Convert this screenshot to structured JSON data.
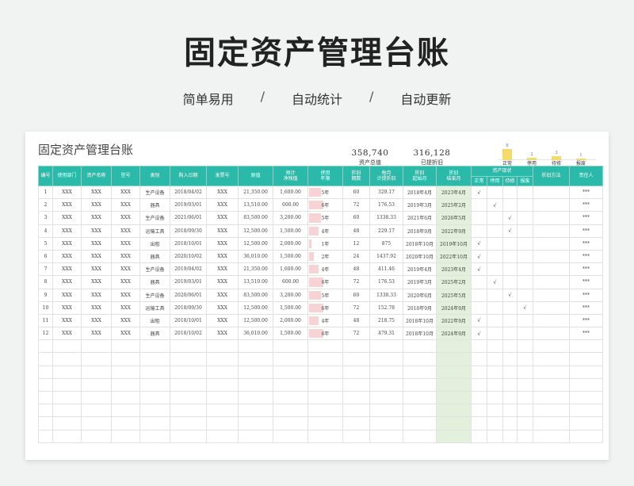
{
  "hero": {
    "title": "固定资产管理台账",
    "tags": [
      "简单易用",
      "自动统计",
      "自动更新"
    ],
    "separator": "/"
  },
  "sheet": {
    "title": "固定资产管理台账",
    "kpis": [
      {
        "value": "358,740",
        "label": "资产总值"
      },
      {
        "value": "316,128",
        "label": "已提折旧"
      }
    ],
    "status_chart": {
      "type": "bar",
      "categories": [
        "正常",
        "停用",
        "待修",
        "报废"
      ],
      "values": [
        8,
        2,
        3,
        1
      ],
      "bar_color": "#f6d96b"
    }
  },
  "colors": {
    "header_bg": "#2bb9a9",
    "life_bar": "#f8d3d6",
    "end_month_bg": "#e3f1dc",
    "end_month_text": "#c0392b"
  },
  "table": {
    "headers": [
      "编号",
      "使用部门",
      "资产名称",
      "型号",
      "类别",
      "购入日期",
      "发票号",
      "原值",
      "预计\n净残值",
      "使用\n年限",
      "折旧\n期数",
      "每月\n计提折旧",
      "折旧\n起始月",
      "折旧\n结束月",
      "资产现状",
      "折旧方法",
      "责任人"
    ],
    "status_headers": [
      "正常",
      "停用",
      "待修",
      "报废"
    ],
    "check": "√",
    "rows": [
      {
        "id": "1",
        "dept": "XXX",
        "name": "XXX",
        "model": "XXX",
        "category": "生产设备",
        "date": "2018/04/02",
        "invoice": "XXX",
        "cost": "21,350.00",
        "salvage": "1,600.00",
        "life": "5年",
        "life_ratio": 0.5,
        "periods": "60",
        "monthly": "329.17",
        "start": "2018年4月",
        "end": "2023年4月",
        "status": "正常",
        "method": "",
        "owner": "***"
      },
      {
        "id": "2",
        "dept": "XXX",
        "name": "XXX",
        "model": "XXX",
        "category": "器具",
        "date": "2019/03/01",
        "invoice": "XXX",
        "cost": "13,510.00",
        "salvage": "600.00",
        "life": "6年",
        "life_ratio": 0.6,
        "periods": "72",
        "monthly": "176.53",
        "start": "2019年3月",
        "end": "2025年2月",
        "status": "停用",
        "method": "",
        "owner": "***"
      },
      {
        "id": "3",
        "dept": "XXX",
        "name": "XXX",
        "model": "XXX",
        "category": "生产设备",
        "date": "2021/06/01",
        "invoice": "XXX",
        "cost": "83,500.00",
        "salvage": "3,200.00",
        "life": "5年",
        "life_ratio": 0.5,
        "periods": "60",
        "monthly": "1338.33",
        "start": "2021年6月",
        "end": "2026年5月",
        "status": "待修",
        "method": "",
        "owner": "***"
      },
      {
        "id": "4",
        "dept": "XXX",
        "name": "XXX",
        "model": "XXX",
        "category": "运输工具",
        "date": "2018/09/30",
        "invoice": "XXX",
        "cost": "12,500.00",
        "salvage": "1,500.00",
        "life": "4年",
        "life_ratio": 0.4,
        "periods": "48",
        "monthly": "229.17",
        "start": "2018年9月",
        "end": "2022年9月",
        "status": "待修",
        "method": "",
        "owner": "***"
      },
      {
        "id": "5",
        "dept": "XXX",
        "name": "XXX",
        "model": "XXX",
        "category": "出租",
        "date": "2018/10/01",
        "invoice": "XXX",
        "cost": "12,500.00",
        "salvage": "2,000.00",
        "life": "1年",
        "life_ratio": 0.1,
        "periods": "12",
        "monthly": "875",
        "start": "2018年10月",
        "end": "2019年10月",
        "status": "正常",
        "method": "",
        "owner": "***"
      },
      {
        "id": "6",
        "dept": "XXX",
        "name": "XXX",
        "model": "XXX",
        "category": "器具",
        "date": "2020/10/02",
        "invoice": "XXX",
        "cost": "36,010.00",
        "salvage": "1,500.00",
        "life": "2年",
        "life_ratio": 0.2,
        "periods": "24",
        "monthly": "1437.92",
        "start": "2020年10月",
        "end": "2022年10月",
        "status": "正常",
        "method": "",
        "owner": "***"
      },
      {
        "id": "7",
        "dept": "XXX",
        "name": "XXX",
        "model": "XXX",
        "category": "生产设备",
        "date": "2019/04/02",
        "invoice": "XXX",
        "cost": "21,350.00",
        "salvage": "1,600.00",
        "life": "4年",
        "life_ratio": 0.4,
        "periods": "48",
        "monthly": "411.46",
        "start": "2019年4月",
        "end": "2023年4月",
        "status": "正常",
        "method": "",
        "owner": "***"
      },
      {
        "id": "8",
        "dept": "XXX",
        "name": "XXX",
        "model": "XXX",
        "category": "器具",
        "date": "2019/03/01",
        "invoice": "XXX",
        "cost": "13,510.00",
        "salvage": "600.00",
        "life": "6年",
        "life_ratio": 0.6,
        "periods": "72",
        "monthly": "176.53",
        "start": "2019年3月",
        "end": "2025年2月",
        "status": "停用",
        "method": "",
        "owner": "***"
      },
      {
        "id": "9",
        "dept": "XXX",
        "name": "XXX",
        "model": "XXX",
        "category": "生产设备",
        "date": "2020/06/01",
        "invoice": "XXX",
        "cost": "83,500.00",
        "salvage": "3,200.00",
        "life": "5年",
        "life_ratio": 0.5,
        "periods": "60",
        "monthly": "1338.33",
        "start": "2020年6月",
        "end": "2025年5月",
        "status": "待修",
        "method": "",
        "owner": "***"
      },
      {
        "id": "10",
        "dept": "XXX",
        "name": "XXX",
        "model": "XXX",
        "category": "运输工具",
        "date": "2018/09/30",
        "invoice": "XXX",
        "cost": "12,500.00",
        "salvage": "1,500.00",
        "life": "6年",
        "life_ratio": 0.6,
        "periods": "72",
        "monthly": "152.78",
        "start": "2018年9月",
        "end": "2024年9月",
        "status": "报废",
        "method": "",
        "owner": "***"
      },
      {
        "id": "11",
        "dept": "XXX",
        "name": "XXX",
        "model": "XXX",
        "category": "出租",
        "date": "2018/10/01",
        "invoice": "XXX",
        "cost": "12,500.00",
        "salvage": "2,000.00",
        "life": "4年",
        "life_ratio": 0.4,
        "periods": "48",
        "monthly": "218.75",
        "start": "2018年10月",
        "end": "2022年9月",
        "status": "正常",
        "method": "",
        "owner": "***"
      },
      {
        "id": "12",
        "dept": "XXX",
        "name": "XXX",
        "model": "XXX",
        "category": "器具",
        "date": "2018/10/02",
        "invoice": "XXX",
        "cost": "36,010.00",
        "salvage": "1,500.00",
        "life": "6年",
        "life_ratio": 0.6,
        "periods": "72",
        "monthly": "479.31",
        "start": "2018年10月",
        "end": "2024年9月",
        "status": "正常",
        "method": "",
        "owner": "***"
      }
    ],
    "empty_rows": 8
  }
}
